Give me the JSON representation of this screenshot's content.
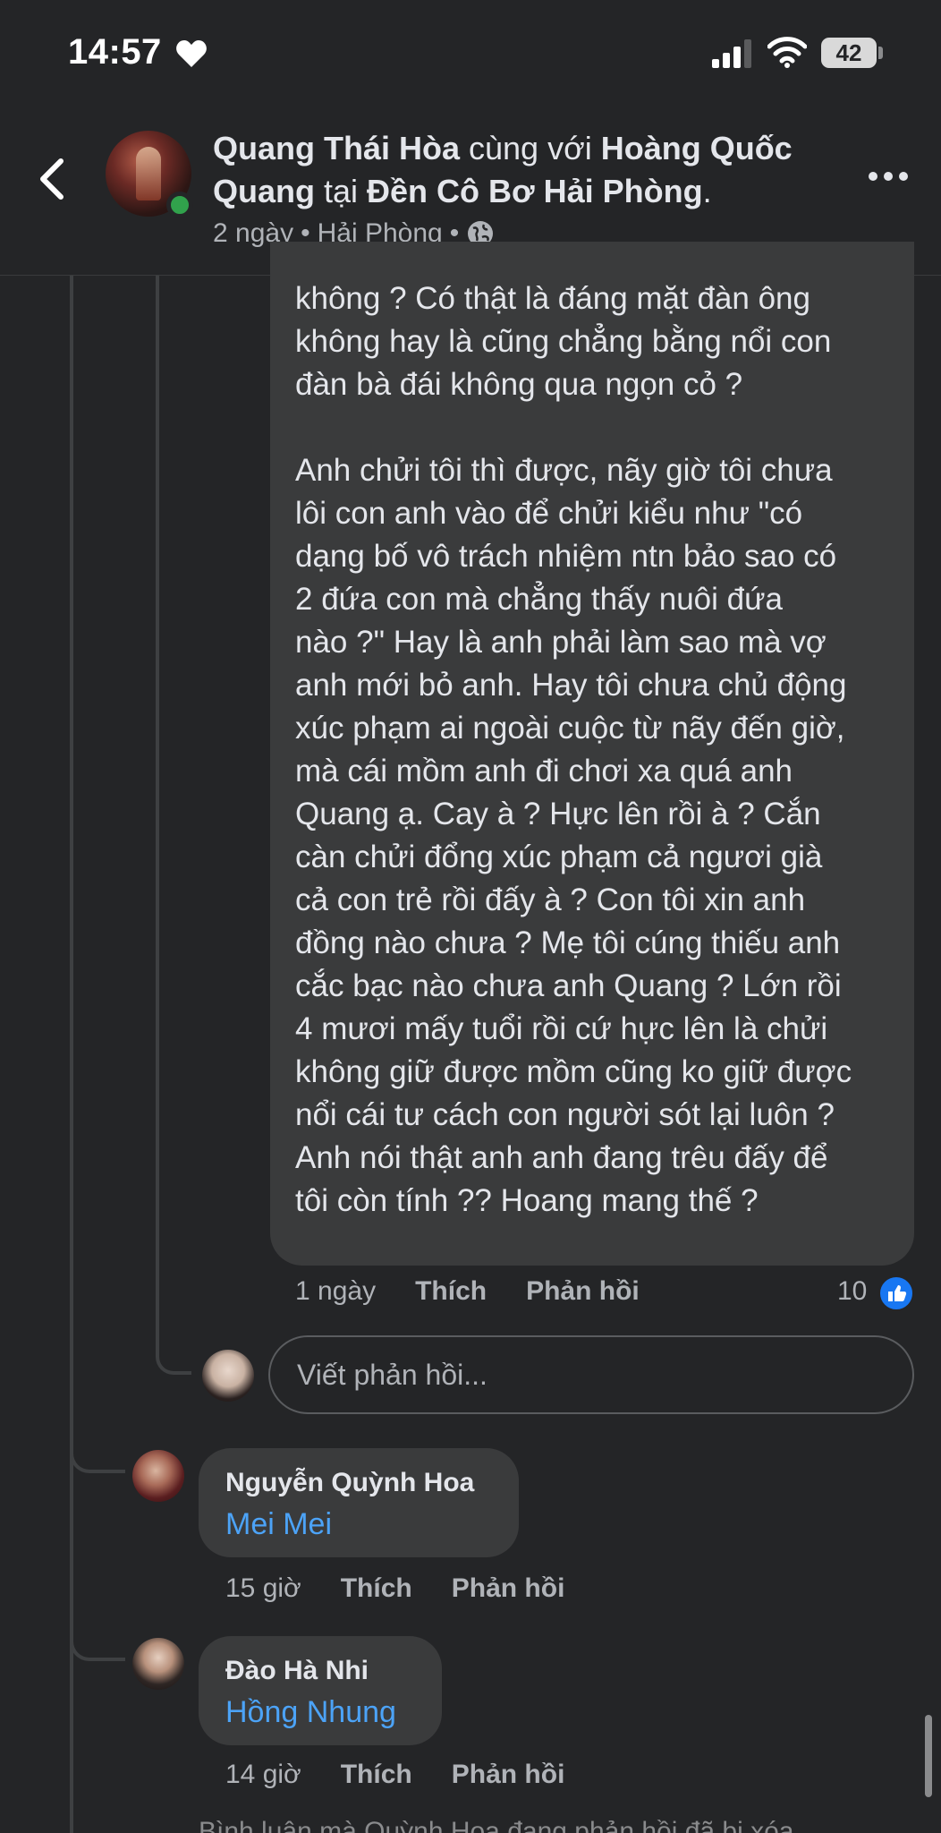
{
  "status_bar": {
    "time": "14:57",
    "battery": "42"
  },
  "header": {
    "author": "Quang Thái Hòa",
    "with_text": " cùng với ",
    "tagged": "Hoàng Quốc Quang",
    "at_text": " tại ",
    "place": "Đền Cô Bơ Hải Phòng",
    "period": ".",
    "time_ago": "2 ngày",
    "separator": "•",
    "location": "Hải Phòng",
    "separator2": "•"
  },
  "comment": {
    "text": "không ? Có thật là đáng mặt đàn ông\nkhông hay là cũng chẳng bằng nổi con\nđàn bà đái không qua ngọn cỏ ?\n\nAnh chửi tôi thì được, nãy giờ tôi chưa\nlôi con anh vào để chửi kiểu như \"có\ndạng bố vô trách nhiệm ntn bảo sao có\n2 đứa con mà chẳng thấy nuôi đứa\nnào ?\" Hay là anh phải làm sao mà vợ\nanh mới bỏ anh. Hay tôi chưa chủ động\nxúc phạm ai ngoài cuộc từ nãy đến giờ,\nmà cái mồm anh đi chơi xa quá anh\nQuang ạ. Cay à ? Hực lên rồi à ? Cắn\ncàn chửi đổng xúc phạm cả ngươi già\ncả con trẻ rồi đấy à ? Con tôi xin anh\nđồng nào chưa ? Mẹ tôi cúng thiếu anh\ncắc bạc nào chưa anh Quang ? Lớn rồi\n4 mươi mấy tuổi rồi cứ hực lên là chửi\nkhông giữ được mồm cũng ko giữ được\nnổi cái tư cách con người sót lại luôn ?\nAnh nói thật anh anh đang trêu đấy để\ntôi còn tính ?? Hoang mang thế ?",
    "time": "1 ngày",
    "like_label": "Thích",
    "reply_label": "Phản hồi",
    "like_count": "10"
  },
  "reply_box": {
    "placeholder": "Viết phản hồi..."
  },
  "replies": [
    {
      "name": "Nguyễn Quỳnh Hoa",
      "tag": "Mei Mei",
      "time": "15 giờ",
      "like_label": "Thích",
      "reply_label": "Phản hồi"
    },
    {
      "name": "Đào Hà Nhi",
      "tag": "Hồng Nhung",
      "time": "14 giờ",
      "like_label": "Thích",
      "reply_label": "Phản hồi"
    }
  ],
  "bottom_note": "Bình luận mà Quỳnh Hoa đang phản hồi đã bị xóa",
  "colors": {
    "background": "#242527",
    "bubble": "#3a3b3c",
    "tag_blue": "#4ca3f7",
    "online_green": "#31a24c",
    "like_blue": "#1877f2"
  },
  "icons": [
    "heart-icon",
    "signal-icon",
    "wifi-icon",
    "back-icon",
    "globe-icon",
    "more-icon",
    "like-icon"
  ]
}
